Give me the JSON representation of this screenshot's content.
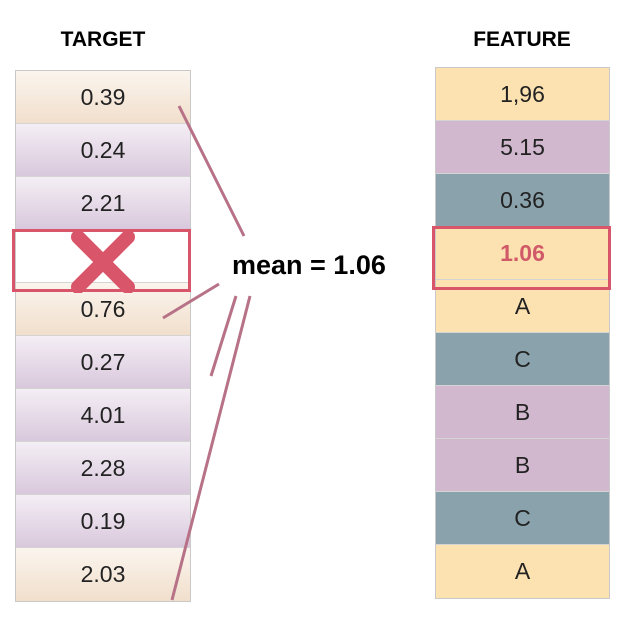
{
  "target": {
    "title": "TARGET",
    "values": [
      "0.39",
      "0.24",
      "2.21",
      "",
      "0.76",
      "0.27",
      "4.01",
      "2.28",
      "0.19",
      "2.03"
    ]
  },
  "feature": {
    "title": "FEATURE",
    "values": [
      "1,96",
      "5.15",
      "0.36",
      "1.06",
      "A",
      "C",
      "B",
      "B",
      "C",
      "A"
    ]
  },
  "mean_label": "mean = 1.06",
  "colors": {
    "highlight": "#d9566a",
    "peach": "#fde2b1",
    "purple": "#d2b8cf",
    "slate_blue": "#8aa2ab",
    "connector": "#b77287"
  },
  "icons": {
    "missing": "x-mark-icon"
  }
}
